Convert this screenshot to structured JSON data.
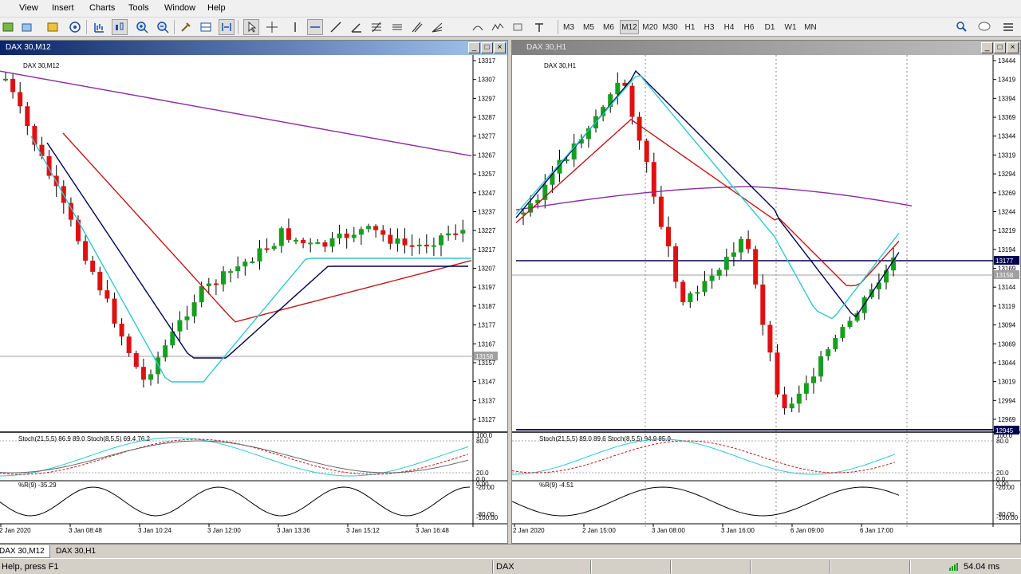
{
  "menu": [
    "View",
    "Insert",
    "Charts",
    "Tools",
    "Window",
    "Help"
  ],
  "timeframes": [
    "M3",
    "M5",
    "M6",
    "M12",
    "M20",
    "M30",
    "H1",
    "H3",
    "H4",
    "H6",
    "D1",
    "W1",
    "MN"
  ],
  "active_timeframe": "M12",
  "toolbar_icons": [
    "new-chart-icon",
    "profiles-icon",
    "market-watch-icon",
    "signal-icon",
    "bar-chart-icon",
    "candles-icon",
    "zoom-in-icon",
    "zoom-out-icon",
    "properties-icon",
    "tile-icon",
    "autoscroll-icon",
    "cursor-icon",
    "crosshair-icon",
    "vertical-line-icon",
    "horizontal-line-icon",
    "trendline-icon",
    "angle-icon",
    "fibo-icon",
    "channel-icon",
    "pitchfork-icon",
    "fan-icon",
    "arc-icon",
    "rectangle-icon",
    "text-icon",
    "search-icon",
    "chat-icon",
    "menu-icon"
  ],
  "windows": {
    "left": {
      "title": "DAX 30,M12",
      "subtitle": "DAX 30,M12",
      "stoch_label": "Stoch(21,5,5) 86.9 89.0 Stoch(8,5,5) 69.4 76.2",
      "wpr_label": "%R(9) -35.29",
      "price_ticks": [
        "13317",
        "13307",
        "13297",
        "13287",
        "13277",
        "13267",
        "13257",
        "13247",
        "13237",
        "13227",
        "13217",
        "13207",
        "13197",
        "13187",
        "13177",
        "13167",
        "13157",
        "13147",
        "13137",
        "13127"
      ],
      "current_price": "13158",
      "stoch_ticks": [
        "100.0",
        "80.0",
        "20.0",
        "0.0"
      ],
      "wpr_ticks": [
        "0.00",
        "-20.00",
        "-80.00",
        "-100.00"
      ],
      "time_labels": [
        "2 Jan 2020",
        "3 Jan 08:48",
        "3 Jan 10:24",
        "3 Jan 12:00",
        "3 Jan 13:36",
        "3 Jan 15:12",
        "3 Jan 16:48"
      ]
    },
    "right": {
      "title": "DAX 30,H1",
      "subtitle": "DAX 30,H1",
      "stoch_label": "Stoch(21,5,5) 89.0 89.6 Stoch(8,5,5) 94.9 85.9",
      "wpr_label": "%R(9) -4.51",
      "price_ticks": [
        "13444",
        "13419",
        "13394",
        "13369",
        "13344",
        "13319",
        "13294",
        "13269",
        "13244",
        "13219",
        "13194",
        "13169",
        "13144",
        "13119",
        "13094",
        "13069",
        "13044",
        "13019",
        "12994",
        "12969"
      ],
      "hline_label": "13177",
      "current_price": "13158",
      "low_label": "12945",
      "stoch_ticks": [
        "100.0",
        "80.0",
        "20.0",
        "0.0"
      ],
      "wpr_ticks": [
        "0.00",
        "-20.00",
        "-80.00",
        "-100.00"
      ],
      "time_labels": [
        "2 Jan 2020",
        "2 Jan 15:00",
        "3 Jan 08:00",
        "3 Jan 16:00",
        "6 Jan 09:00",
        "6 Jan 17:00"
      ]
    }
  },
  "tabs": [
    "DAX 30,M12",
    "DAX 30,H1"
  ],
  "active_tab": "DAX 30,M12",
  "status": {
    "help": "Help, press F1",
    "profile": "DAX",
    "ping": "54.04 ms"
  },
  "colors": {
    "bull": "#14a01e",
    "bear": "#e01010",
    "ema_fast": "#30c8d0",
    "ema_mid": "#000050",
    "ema_slow": "#c01818",
    "ma_long": "#8a2aa0"
  }
}
